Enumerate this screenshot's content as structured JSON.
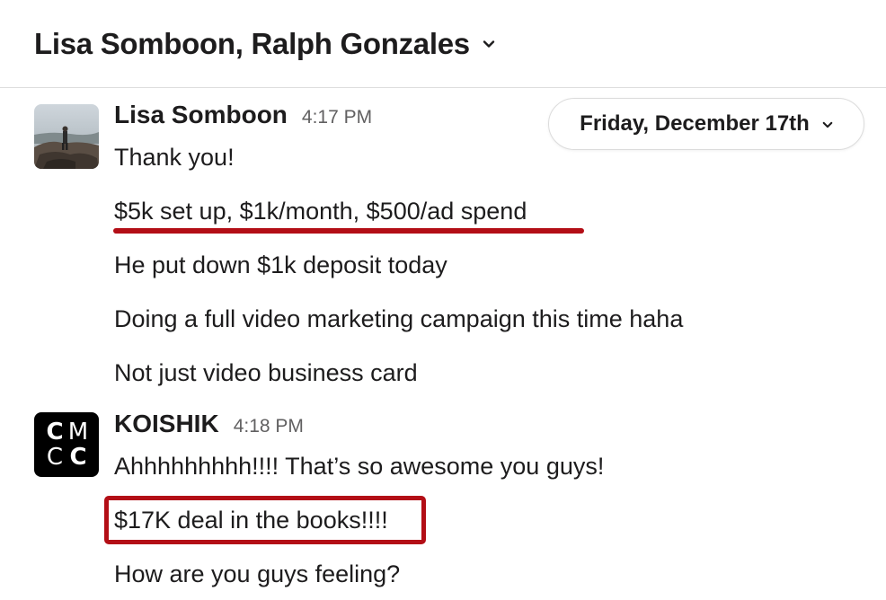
{
  "header": {
    "title": "Lisa Somboon, Ralph Gonzales",
    "title_chevron_icon": "chevron-down-icon"
  },
  "date_divider": {
    "label": "Friday, December 17th",
    "chevron_icon": "chevron-down-icon"
  },
  "messages": [
    {
      "sender": "Lisa Somboon",
      "time": "4:17 PM",
      "avatar": "photo-avatar",
      "lines": [
        "Thank you!",
        "$5k set up, $1k/month, $500/ad spend",
        "He put down $1k deposit today",
        "Doing a full video marketing campaign this time haha",
        "Not just video business card"
      ]
    },
    {
      "sender": "KOISHIK",
      "time": "4:18 PM",
      "avatar": "cmcc-logo-avatar",
      "avatar_letters": [
        "C",
        "M",
        "C",
        "C"
      ],
      "lines": [
        "Ahhhhhhhhh!!!! That’s so awesome you guys!",
        "$17K deal in the books!!!!",
        "How are you guys feeling?"
      ]
    }
  ],
  "colors": {
    "annotation_red": "#b30e16",
    "text": "#1d1c1d",
    "muted": "#616061",
    "divider": "#dddddd"
  }
}
